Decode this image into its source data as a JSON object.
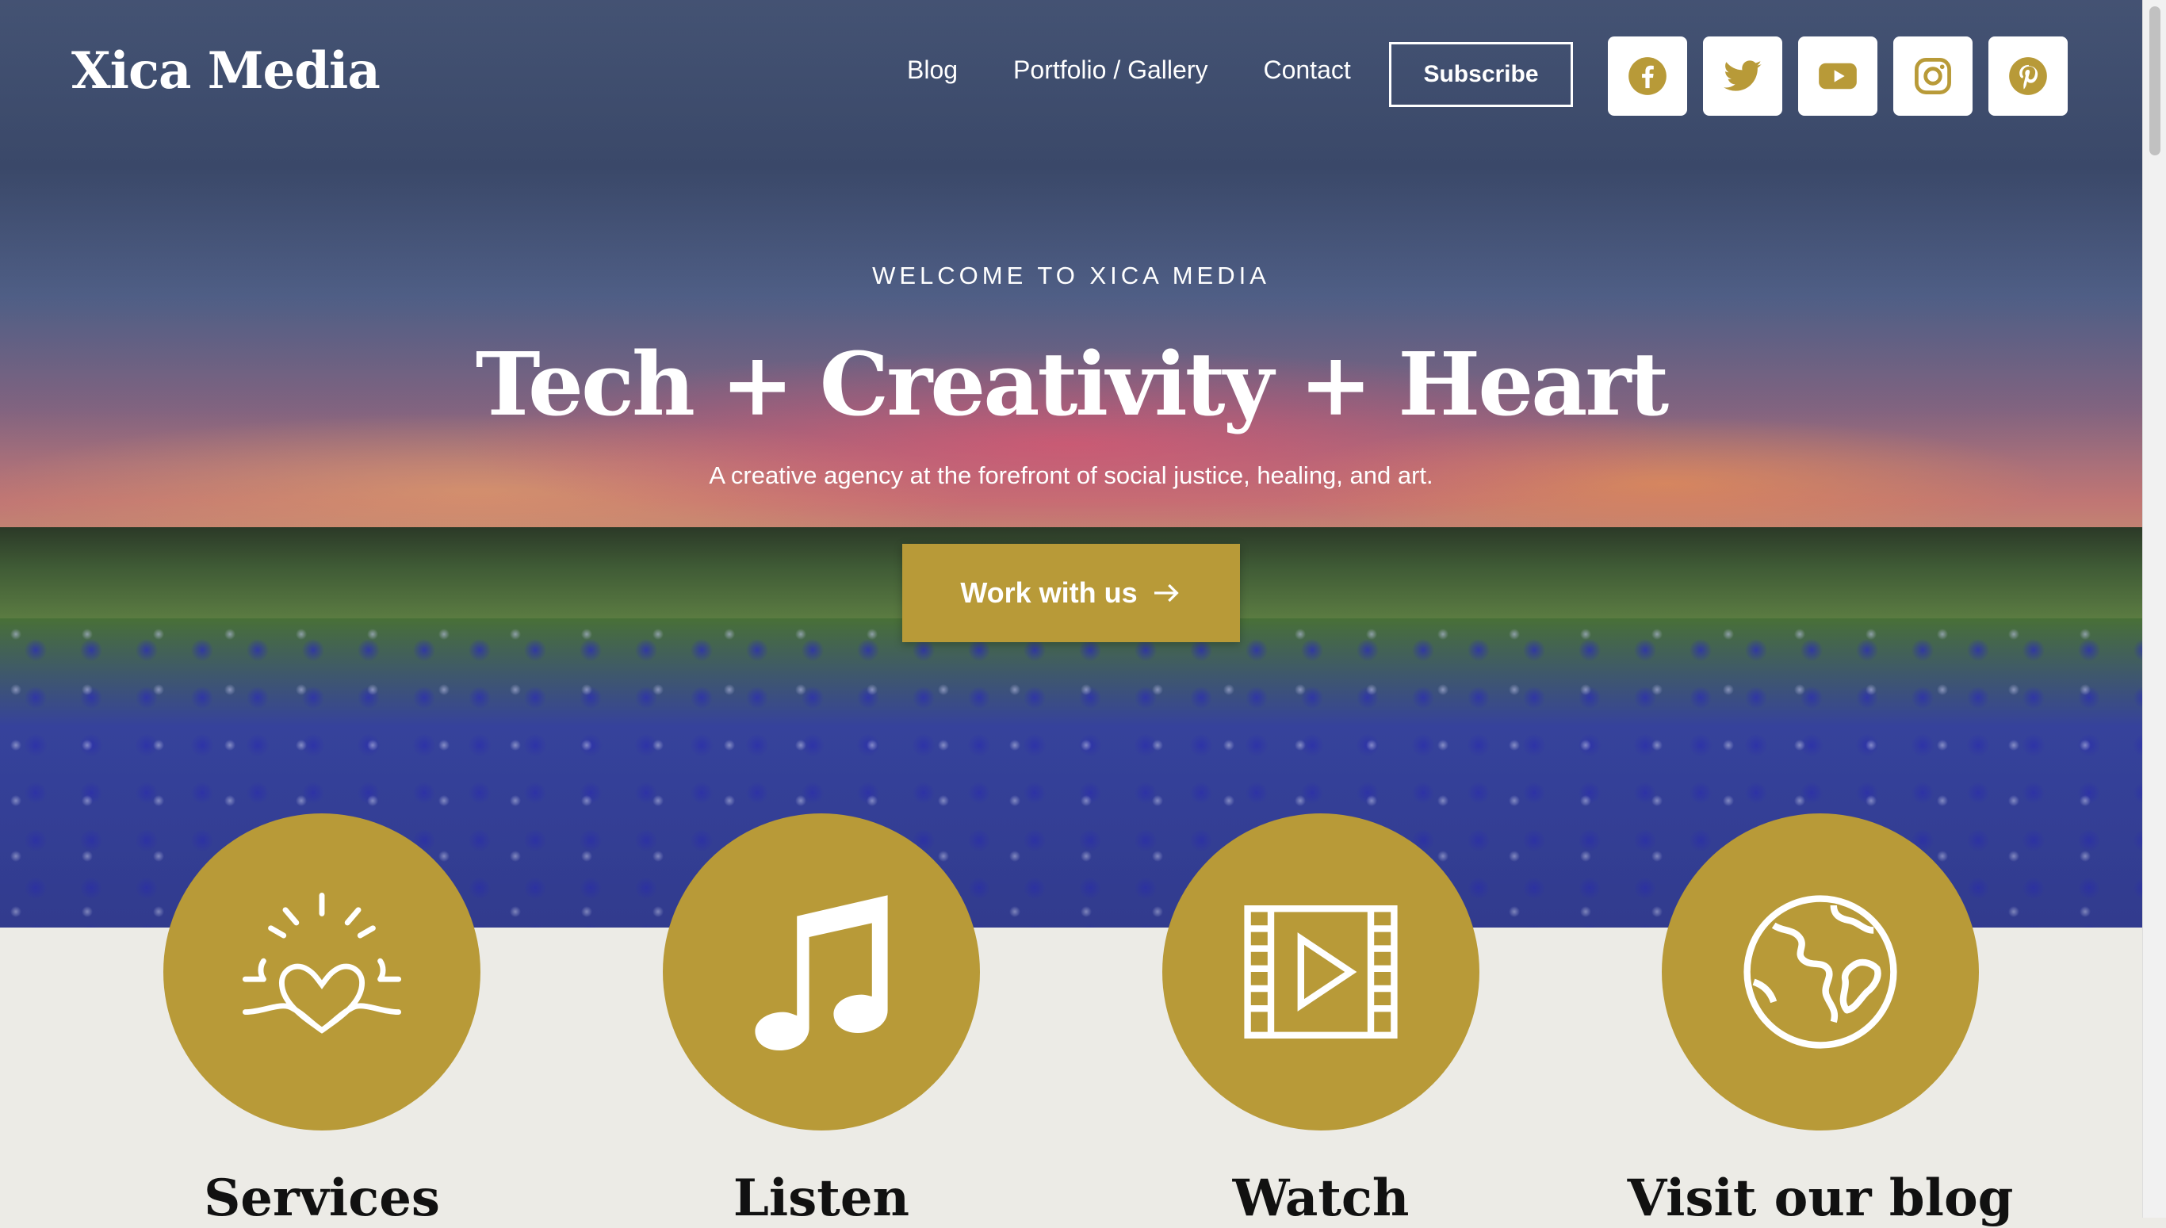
{
  "header": {
    "logo": "Xica Media",
    "nav": [
      "Blog",
      "Portfolio / Gallery",
      "Contact"
    ],
    "subscribe_label": "Subscribe",
    "social_icons": [
      "facebook-icon",
      "twitter-icon",
      "youtube-icon",
      "instagram-icon",
      "pinterest-icon"
    ],
    "social_icon_color": "#b89a38"
  },
  "hero": {
    "eyebrow": "WELCOME TO XICA MEDIA",
    "headline": "Tech + Creativity + Heart",
    "tagline": "A creative agency at the forefront of social justice, healing, and art.",
    "cta_label": "Work with us",
    "cta_color": "#b89a38"
  },
  "features": [
    {
      "title": "Services",
      "icon": "heart-hands-icon"
    },
    {
      "title": "Listen",
      "icon": "music-note-icon"
    },
    {
      "title": "Watch",
      "icon": "film-play-icon"
    },
    {
      "title": "Visit our blog",
      "icon": "globe-icon"
    }
  ],
  "colors": {
    "accent": "#b89a38",
    "section_background": "#ecebe6"
  }
}
